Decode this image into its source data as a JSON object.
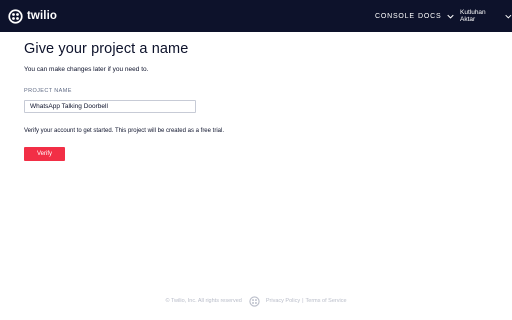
{
  "header": {
    "logo_text": "twilio",
    "nav": {
      "console": "CONSOLE",
      "docs": "DOCS",
      "user": "Kutluhan Aktar"
    }
  },
  "main": {
    "title": "Give your project a name",
    "subtitle": "You can make changes later if you need to.",
    "project_name_label": "PROJECT NAME",
    "project_name_value": "WhatsApp Talking Doorbell",
    "verify_text": "Verify your account to get started. This project will be created as a free trial.",
    "verify_button": "Verify"
  },
  "footer": {
    "copyright": "© Twilio, Inc. All rights reserved",
    "privacy": "Privacy Policy",
    "divider": "|",
    "terms": "Terms of Service"
  },
  "colors": {
    "header_bg": "#0d122b",
    "brand_red": "#f22f46",
    "text": "#0d122b"
  },
  "icons": [
    "twilio-logo-icon",
    "chevron-down-icon",
    "twilio-footer-logo-icon"
  ]
}
